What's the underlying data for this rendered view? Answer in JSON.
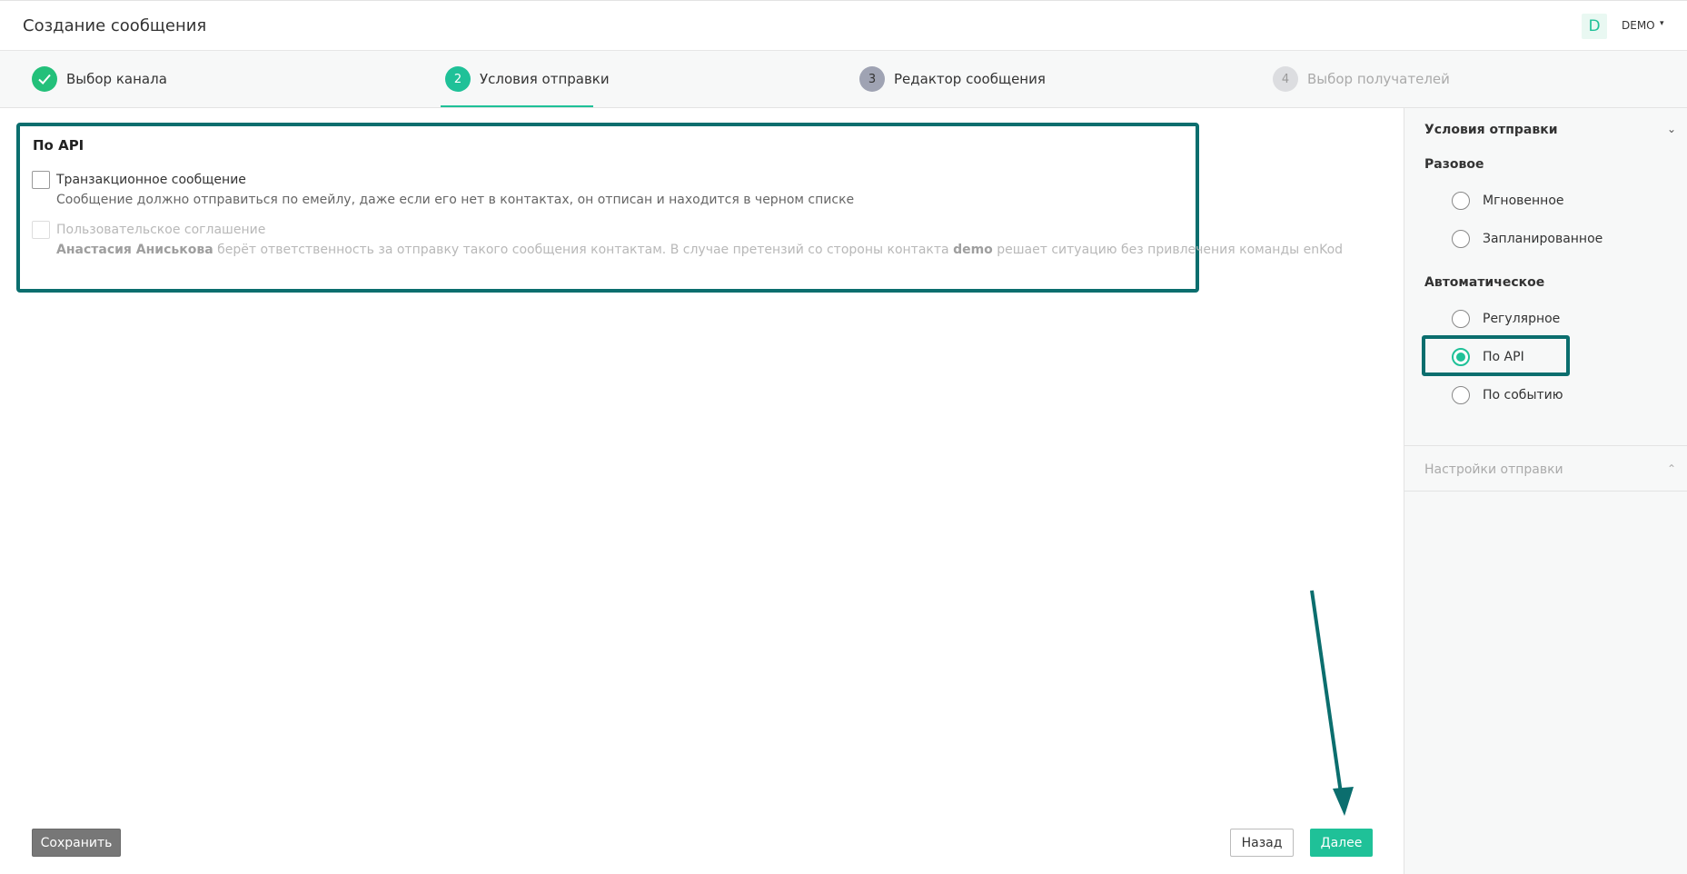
{
  "header": {
    "title": "Создание сообщения",
    "user_initial": "D",
    "user_name": "DEMO",
    "user_caret": "▾"
  },
  "steps": [
    {
      "number": "✓",
      "label": "Выбор канала",
      "state": "done"
    },
    {
      "number": "2",
      "label": "Условия отправки",
      "state": "active"
    },
    {
      "number": "3",
      "label": "Редактор сообщения",
      "state": "next"
    },
    {
      "number": "4",
      "label": "Выбор получателей",
      "state": "disabled"
    }
  ],
  "api_section": {
    "title": "По API",
    "transactional": {
      "label": "Транзакционное сообщение",
      "description": "Сообщение должно отправиться по емейлу, даже если его нет в контактах, он отписан и находится в черном списке",
      "checked": false
    },
    "agreement": {
      "label": "Пользовательское соглашение",
      "user_name": "Анастасия Аниськова",
      "description_part1": " берёт ответственность за отправку такого сообщения контактам. В случае претензий со стороны контакта ",
      "contact_name": "demo",
      "description_part2": " решает ситуацию без привлечения команды enKod",
      "disabled": true
    }
  },
  "footer": {
    "save_label": "Сохранить",
    "back_label": "Назад",
    "next_label": "Далее"
  },
  "sidebar": {
    "section_title": "Условия отправки",
    "section_chevron": "⌄",
    "group_once": "Разовое",
    "group_auto": "Автоматическое",
    "options": [
      {
        "label": "Мгновенное",
        "checked": false
      },
      {
        "label": "Запланированное",
        "checked": false
      },
      {
        "label": "Регулярное",
        "checked": false
      },
      {
        "label": "По API",
        "checked": true
      },
      {
        "label": "По событию",
        "checked": false
      }
    ],
    "settings_title": "Настройки отправки",
    "settings_chevron": "⌃"
  },
  "colors": {
    "accent": "#1fc198",
    "highlight": "#0b6e6e",
    "done": "#23c07a"
  }
}
